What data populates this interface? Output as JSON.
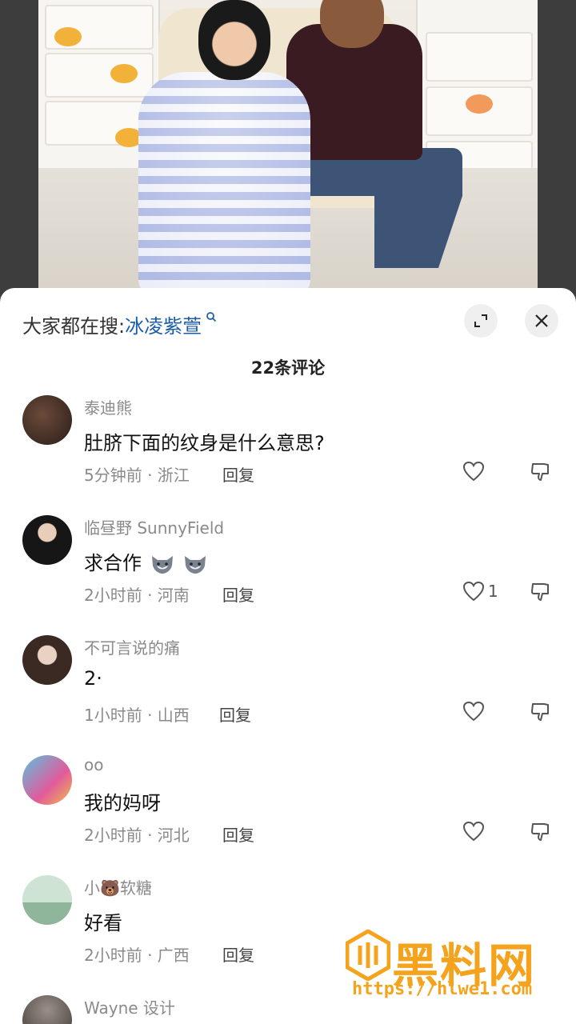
{
  "search_hint": {
    "prefix": "大家都在搜:",
    "query": "冰凌紫萱",
    "query_icon": "search-icon"
  },
  "header": {
    "comment_count": "22条评论",
    "expand_icon": "expand-icon",
    "close_icon": "close-icon"
  },
  "comments": [
    {
      "user": "泰迪熊",
      "text": "肚脐下面的纹身是什么意思?",
      "meta": "5分钟前 · 浙江",
      "reply": "回复",
      "likes": ""
    },
    {
      "user": "临昼野 SunnyField",
      "text": "求合作",
      "meta": "2小时前 · 河南",
      "reply": "回复",
      "likes": "1"
    },
    {
      "user": "不可言说的痛",
      "text": "2·",
      "meta": "1小时前 · 山西",
      "reply": "回复",
      "likes": ""
    },
    {
      "user": "oo",
      "text": "我的妈呀",
      "meta": "2小时前 · 河北",
      "reply": "回复",
      "likes": ""
    },
    {
      "user": "小🐻软糖",
      "text": "好看",
      "meta": "2小时前 · 广西",
      "reply": "回复",
      "likes": ""
    },
    {
      "user": "Wayne 设计",
      "text": "",
      "meta": "",
      "reply": "",
      "likes": ""
    }
  ],
  "watermark": {
    "title": "黑料网",
    "url": "https://hlwe1.com"
  },
  "colors": {
    "link": "#1c5da8",
    "meta": "#8a8a8a",
    "watermark": "#f5a31c"
  }
}
